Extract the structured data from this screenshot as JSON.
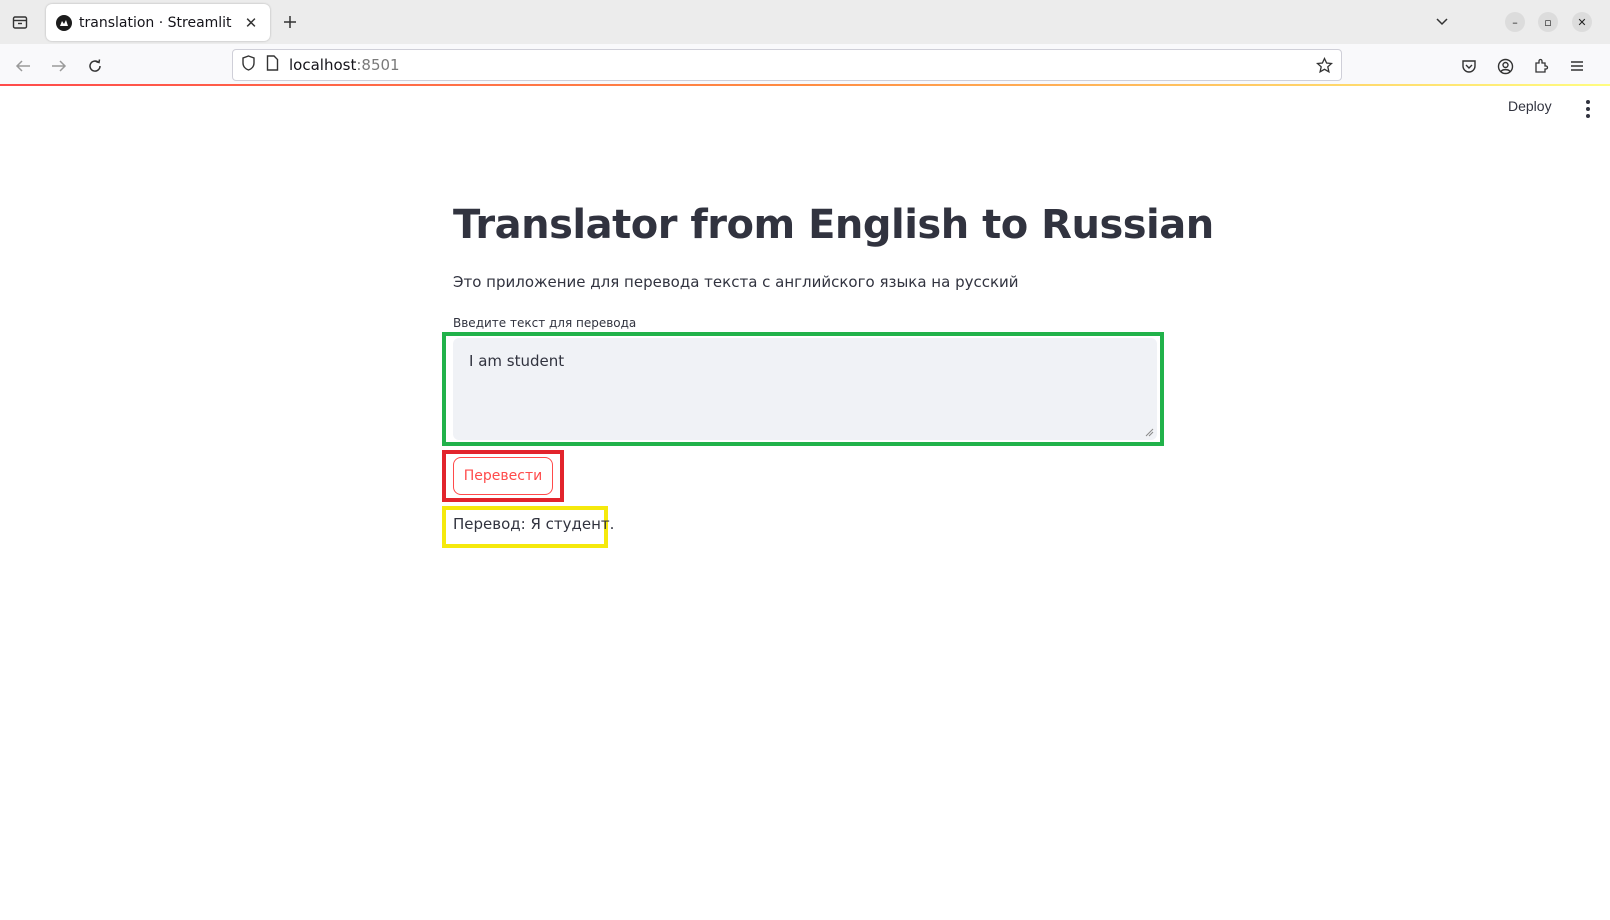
{
  "browser": {
    "tab_title": "translation · Streamlit",
    "url_host": "localhost",
    "url_port": ":8501"
  },
  "app": {
    "deploy_label": "Deploy",
    "title": "Translator from English to Russian",
    "subtitle": "Это приложение для перевода текста с английского языка на русский",
    "input_label": "Введите текст для перевода",
    "input_value": "I am student",
    "button_label": "Перевести",
    "result_text": "Перевод: Я студент."
  },
  "colors": {
    "accent": "#ff4b4b",
    "highlight_input": "#21b24a",
    "highlight_button": "#e2242c",
    "highlight_result": "#f5e90c"
  }
}
